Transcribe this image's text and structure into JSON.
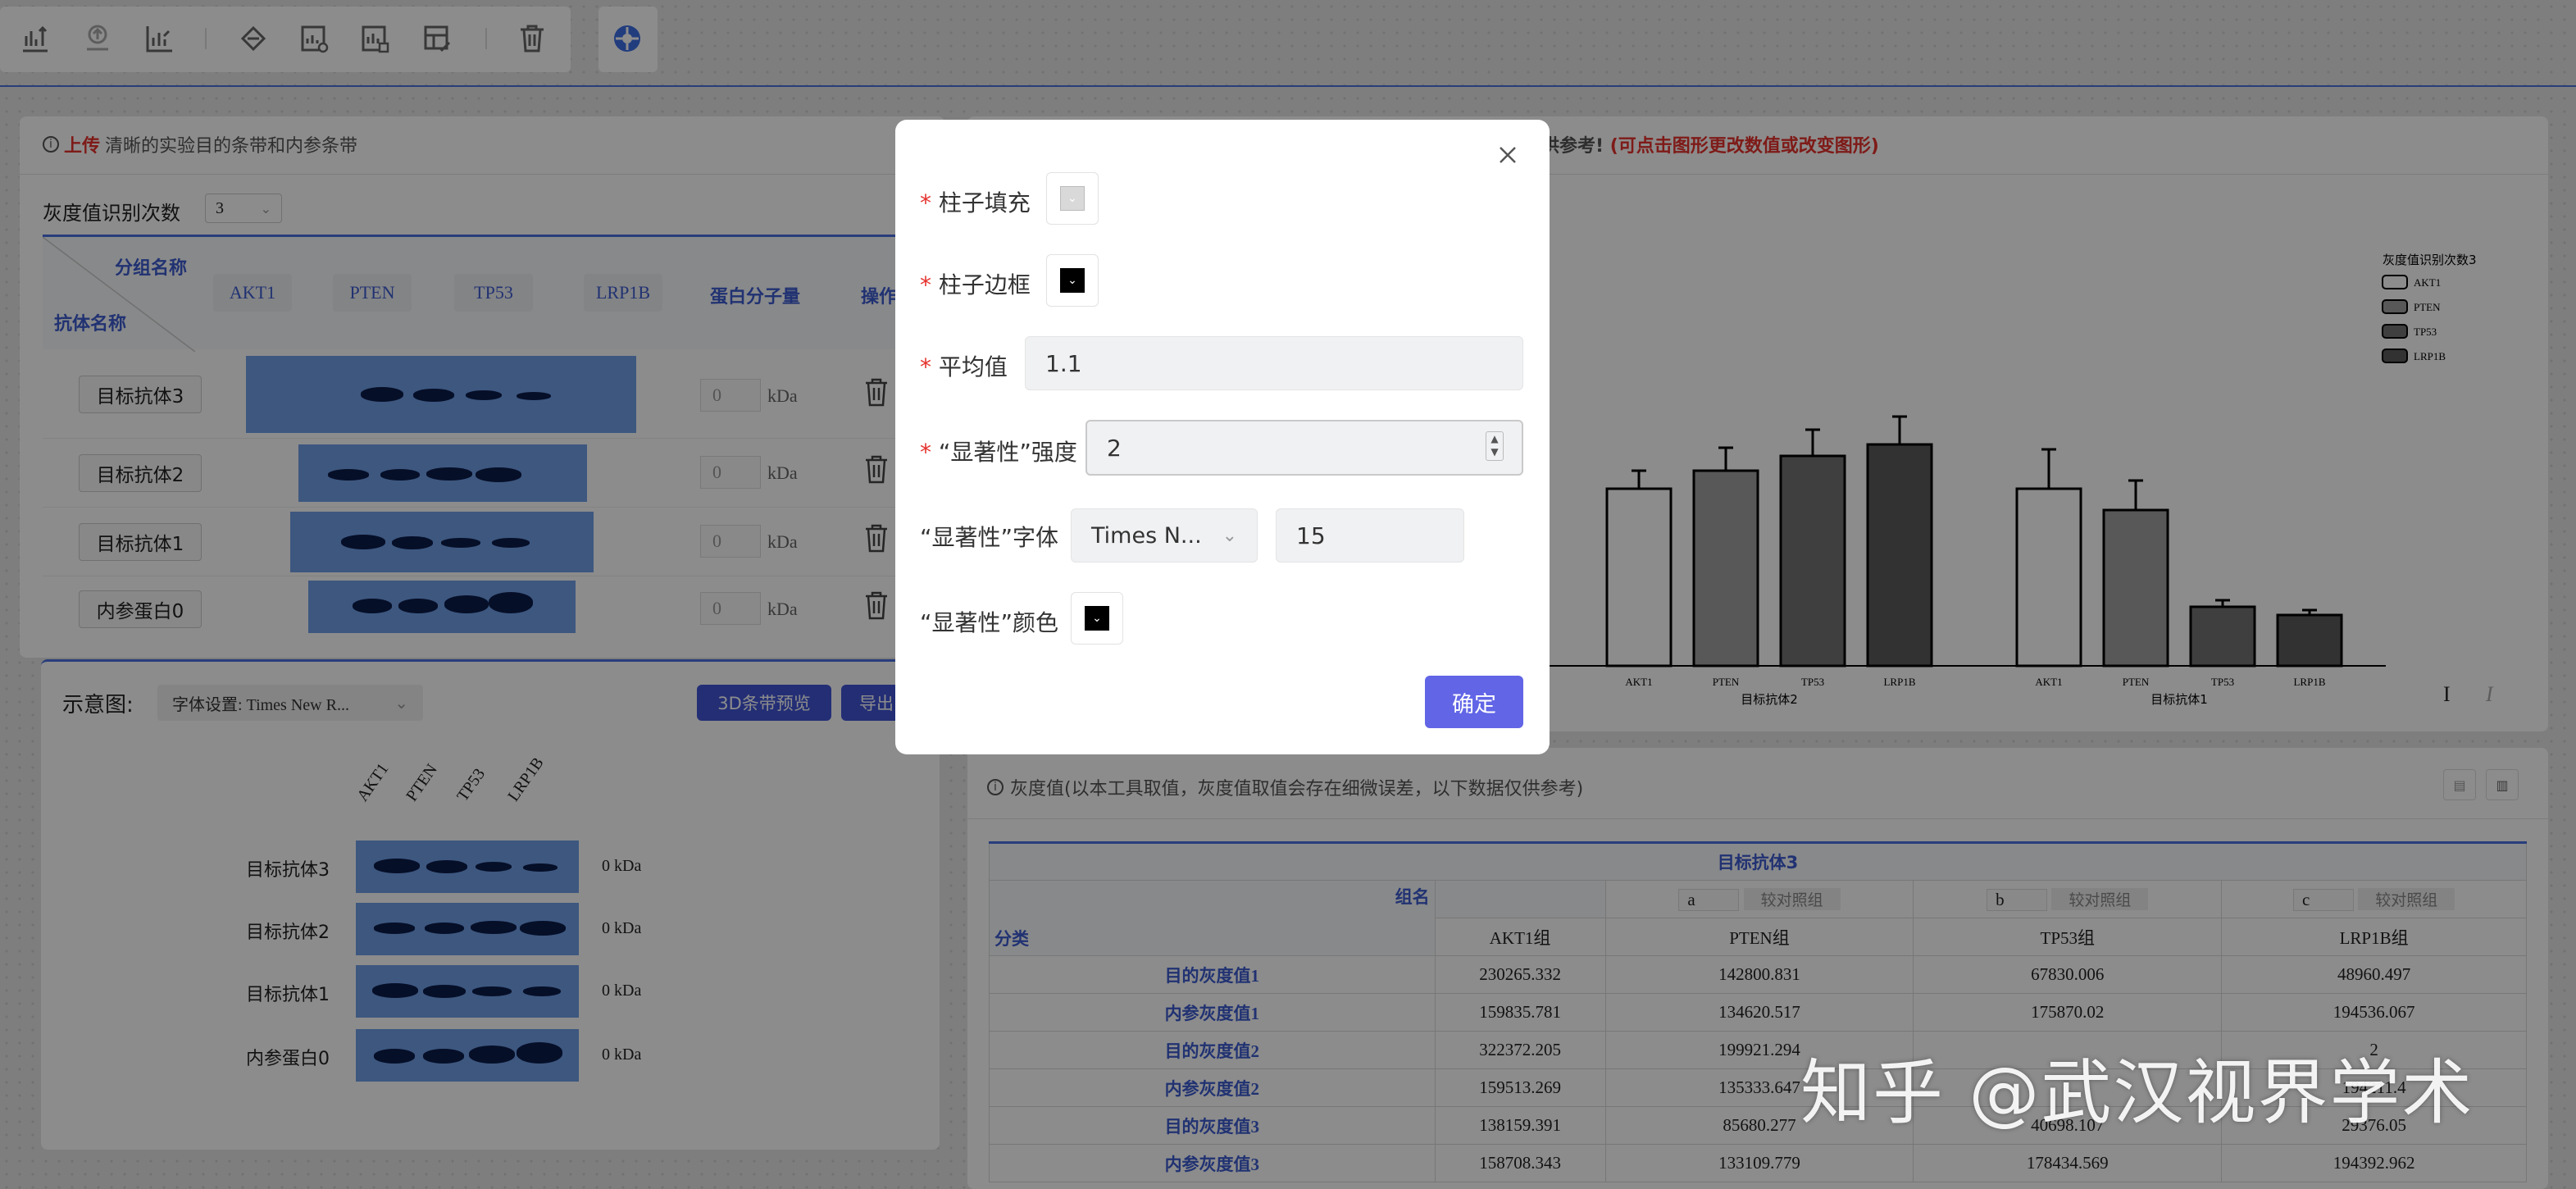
{
  "toolbar": {
    "icons": [
      "upload-export-icon",
      "upload-cloud-icon",
      "bar-chart-icon",
      "layers-icon",
      "chart-settings-icon",
      "chart-grid-icon",
      "chart-edit-icon",
      "delete-icon",
      "analyze-icon"
    ]
  },
  "left_panel": {
    "hint_prefix": "上传",
    "hint_rest": "清晰的实验目的条带和内参条带",
    "count_label": "灰度值识别次数",
    "count_value": "3",
    "group_header": "分组名称",
    "antibody_header": "抗体名称",
    "lanes": [
      "AKT1",
      "PTEN",
      "TP53",
      "LRP1B"
    ],
    "mw_header": "蛋白分子量",
    "op_header": "操作",
    "rows": [
      {
        "name": "目标抗体3",
        "mw": "0",
        "unit": "kDa"
      },
      {
        "name": "目标抗体2",
        "mw": "0",
        "unit": "kDa"
      },
      {
        "name": "目标抗体1",
        "mw": "0",
        "unit": "kDa"
      },
      {
        "name": "内参蛋白0",
        "mw": "0",
        "unit": "kDa"
      }
    ]
  },
  "schematic": {
    "title": "示意图:",
    "font_select": "字体设置: Times New R...",
    "preview_btn": "3D条带预览",
    "export_btn": "导出",
    "lanes": [
      "AKT1",
      "PTEN",
      "TP53",
      "LRP1B"
    ],
    "rows": [
      {
        "name": "目标抗体3",
        "mw": "0 kDa"
      },
      {
        "name": "目标抗体2",
        "mw": "0 kDa"
      },
      {
        "name": "目标抗体1",
        "mw": "0 kDa"
      },
      {
        "name": "内参蛋白0",
        "mw": "0 kDa"
      }
    ]
  },
  "chart_panel": {
    "hint_tail": "供参考!",
    "hint_red": "(可点击图形更改数值或改变图形)",
    "italic_controls": [
      "I",
      "I"
    ]
  },
  "chart_data": {
    "type": "bar",
    "legend_title": "灰度值识别次数3",
    "legend_placement": "top-right",
    "groups": [
      {
        "name": "目标抗体2",
        "categories": [
          "AKT1",
          "PTEN",
          "TP53",
          "LRP1B"
        ],
        "values": [
          1.08,
          1.19,
          1.28,
          1.35
        ],
        "errors": [
          0.11,
          0.14,
          0.16,
          0.17
        ]
      },
      {
        "name": "目标抗体1",
        "categories": [
          "AKT1",
          "PTEN",
          "TP53",
          "LRP1B"
        ],
        "values": [
          1.08,
          0.95,
          0.36,
          0.31
        ],
        "errors": [
          0.24,
          0.18,
          0.04,
          0.03
        ]
      }
    ],
    "series": [
      {
        "name": "AKT1",
        "color": "#ffffff"
      },
      {
        "name": "PTEN",
        "color": "#a0a0a0"
      },
      {
        "name": "TP53",
        "color": "#747474"
      },
      {
        "name": "LRP1B",
        "color": "#5c5c5c"
      }
    ]
  },
  "gray_table": {
    "title": "灰度值(以本工具取值，灰度值取值会存在细微误差，以下数据仅供参考)",
    "band_title": "目标抗体3",
    "group_label": "组名",
    "class_label": "分类",
    "letters": [
      "a",
      "b",
      "c"
    ],
    "compare_label": "较对照组",
    "columns": [
      "AKT1组",
      "PTEN组",
      "TP53组",
      "LRP1B组"
    ],
    "rows": [
      {
        "label": "目的灰度值1",
        "values": [
          "230265.332",
          "142800.831",
          "67830.006",
          "48960.497"
        ]
      },
      {
        "label": "内参灰度值1",
        "values": [
          "159835.781",
          "134620.517",
          "175870.02",
          "194536.067"
        ]
      },
      {
        "label": "目的灰度值2",
        "values": [
          "322372.205",
          "199921.294",
          "",
          "2"
        ]
      },
      {
        "label": "内参灰度值2",
        "values": [
          "159513.269",
          "135333.647",
          "",
          "194211.4"
        ]
      },
      {
        "label": "目的灰度值3",
        "values": [
          "138159.391",
          "85680.277",
          "40698.107",
          "29376.05"
        ]
      },
      {
        "label": "内参灰度值3",
        "values": [
          "158708.343",
          "133109.779",
          "178434.569",
          "194392.962"
        ]
      }
    ]
  },
  "dialog": {
    "fill_label": "柱子填充",
    "border_label": "柱子边框",
    "mean_label": "平均值",
    "mean_value": "1.1",
    "sig_strength_label": "“显著性”强度",
    "sig_strength_value": "2",
    "sig_font_label": "“显著性”字体",
    "sig_font_value": "Times N...",
    "sig_font_size": "15",
    "sig_color_label": "“显著性”颜色",
    "confirm": "确定",
    "required_mark": "*",
    "fill_color": "#d9d9d9",
    "border_color": "#000000",
    "sig_color": "#000000"
  },
  "watermark": "知乎 @武汉视界学术"
}
